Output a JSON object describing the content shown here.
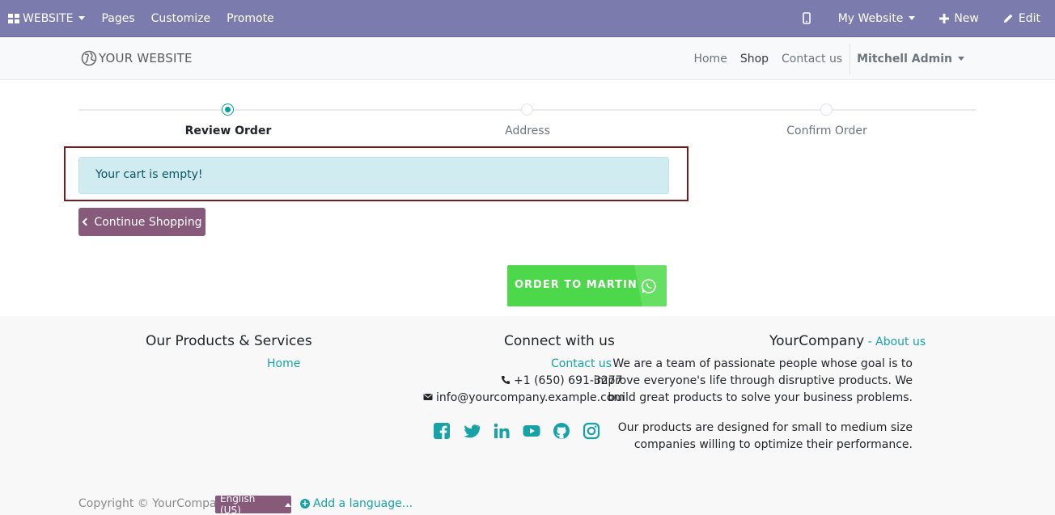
{
  "adminbar": {
    "website_label": "WEBSITE",
    "pages": "Pages",
    "customize": "Customize",
    "promote": "Promote",
    "my_website": "My Website",
    "new": "New",
    "edit": "Edit"
  },
  "navbar": {
    "logo_text": "YOUR WEBSITE",
    "links": [
      "Home",
      "Shop",
      "Contact us"
    ],
    "user": "Mitchell Admin"
  },
  "wizard": {
    "steps": [
      "Review Order",
      "Address",
      "Confirm Order"
    ],
    "active_step": 0
  },
  "alert": {
    "message": "Your cart is empty!"
  },
  "continue_button": "Continue Shopping",
  "whatsapp_button": "ORDER TO MARTIN",
  "footer": {
    "products": {
      "title": "Our Products & Services",
      "link": "Home"
    },
    "connect": {
      "title": "Connect with us",
      "contact": "Contact us",
      "phone": "+1 (650) 691-3277",
      "email": "info@yourcompany.example.com"
    },
    "company": {
      "name": "YourCompany",
      "separator": " - ",
      "about": "About us",
      "para1_line1": "We are a team of passionate people whose goal is to",
      "para1_line2": "improve everyone's life through disruptive products. We",
      "para1_line3": "build great products to solve your business problems.",
      "para2_line1": "Our products are designed for small to medium size",
      "para2_line2": "companies willing to optimize their performance."
    },
    "copyright": "Copyright © YourCompany",
    "language": "English (US)",
    "add_language": "Add a language..."
  },
  "colors": {
    "adminbar": "#7c7bad",
    "primary": "#875a7b",
    "teal": "#00a09d",
    "whatsapp": "#4dd74a"
  }
}
